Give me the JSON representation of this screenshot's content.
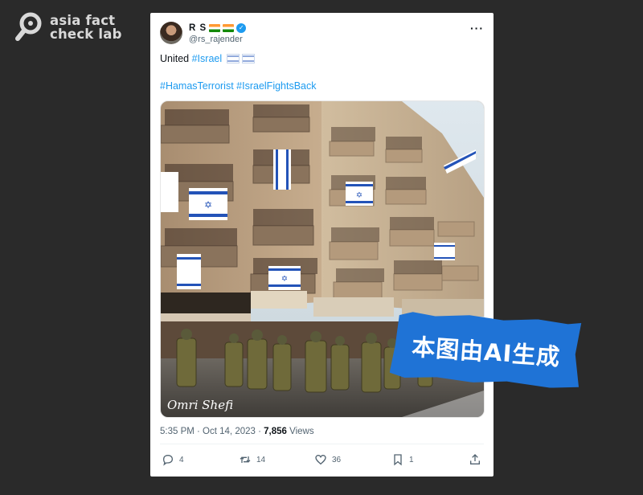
{
  "watermark": {
    "line1": "asia fact",
    "line2": "check lab"
  },
  "tweet": {
    "name": "R S",
    "handle": "@rs_rajender",
    "text_prefix": "United ",
    "text_hashtag": "#Israel",
    "hashtags_line": "#HamasTerrorist #IsraelFightsBack",
    "timestamp": "5:35 PM · Oct 14, 2023 · ",
    "views_count": "7,856",
    "views_label": " Views",
    "replies": "4",
    "retweets": "14",
    "likes": "36",
    "bookmarks": "1",
    "image_signature": "Omri Shefi"
  },
  "sticker": {
    "text": "本图由AI生成"
  },
  "icons": [
    "reply-icon",
    "retweet-icon",
    "like-icon",
    "bookmark-icon",
    "share-icon",
    "verified-icon",
    "more-icon"
  ],
  "colors": {
    "accent": "#1d9bf0",
    "sticker": "#1f73d6",
    "page_bg": "#2a2a2a"
  }
}
